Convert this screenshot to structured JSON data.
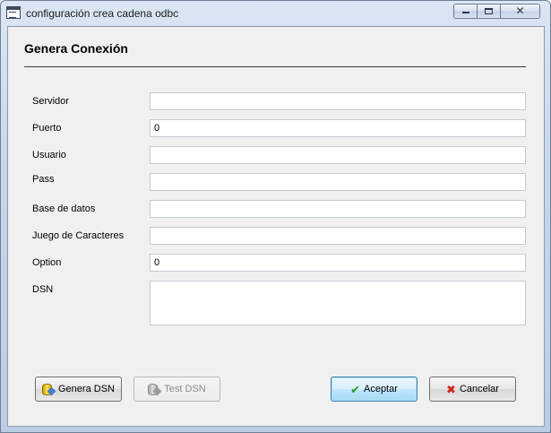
{
  "window": {
    "title": "configuración crea cadena odbc",
    "controls": {
      "minimize_icon": "minimize-icon",
      "maximize_icon": "maximize-icon",
      "close_icon": "close-icon",
      "close_glyph": "✕"
    }
  },
  "header": {
    "title": "Genera Conexión"
  },
  "form": {
    "servidor": {
      "label": "Servidor",
      "value": ""
    },
    "puerto": {
      "label": "Puerto",
      "value": "0"
    },
    "usuario": {
      "label": "Usuario",
      "value": ""
    },
    "pass": {
      "label": "Pass",
      "value": ""
    },
    "base_datos": {
      "label": "Base de datos",
      "value": ""
    },
    "juego_caracteres": {
      "label": "Juego de Caracteres",
      "value": ""
    },
    "option": {
      "label": "Option",
      "value": "0"
    },
    "dsn": {
      "label": "DSN",
      "value": ""
    }
  },
  "buttons": {
    "genera_dsn": {
      "label": "Genera DSN",
      "icon": "database-edit-icon"
    },
    "test_dsn": {
      "label": "Test DSN",
      "icon": "database-test-icon",
      "disabled": true
    },
    "aceptar": {
      "label": "Aceptar",
      "icon": "check-icon"
    },
    "cancelar": {
      "label": "Cancelar",
      "icon": "cancel-x-icon"
    }
  },
  "colors": {
    "titlebar": "#c7d6e9",
    "panel": "#f0f0f0",
    "accept_icon": "#2f9a1e",
    "cancel_icon": "#d2261c"
  }
}
